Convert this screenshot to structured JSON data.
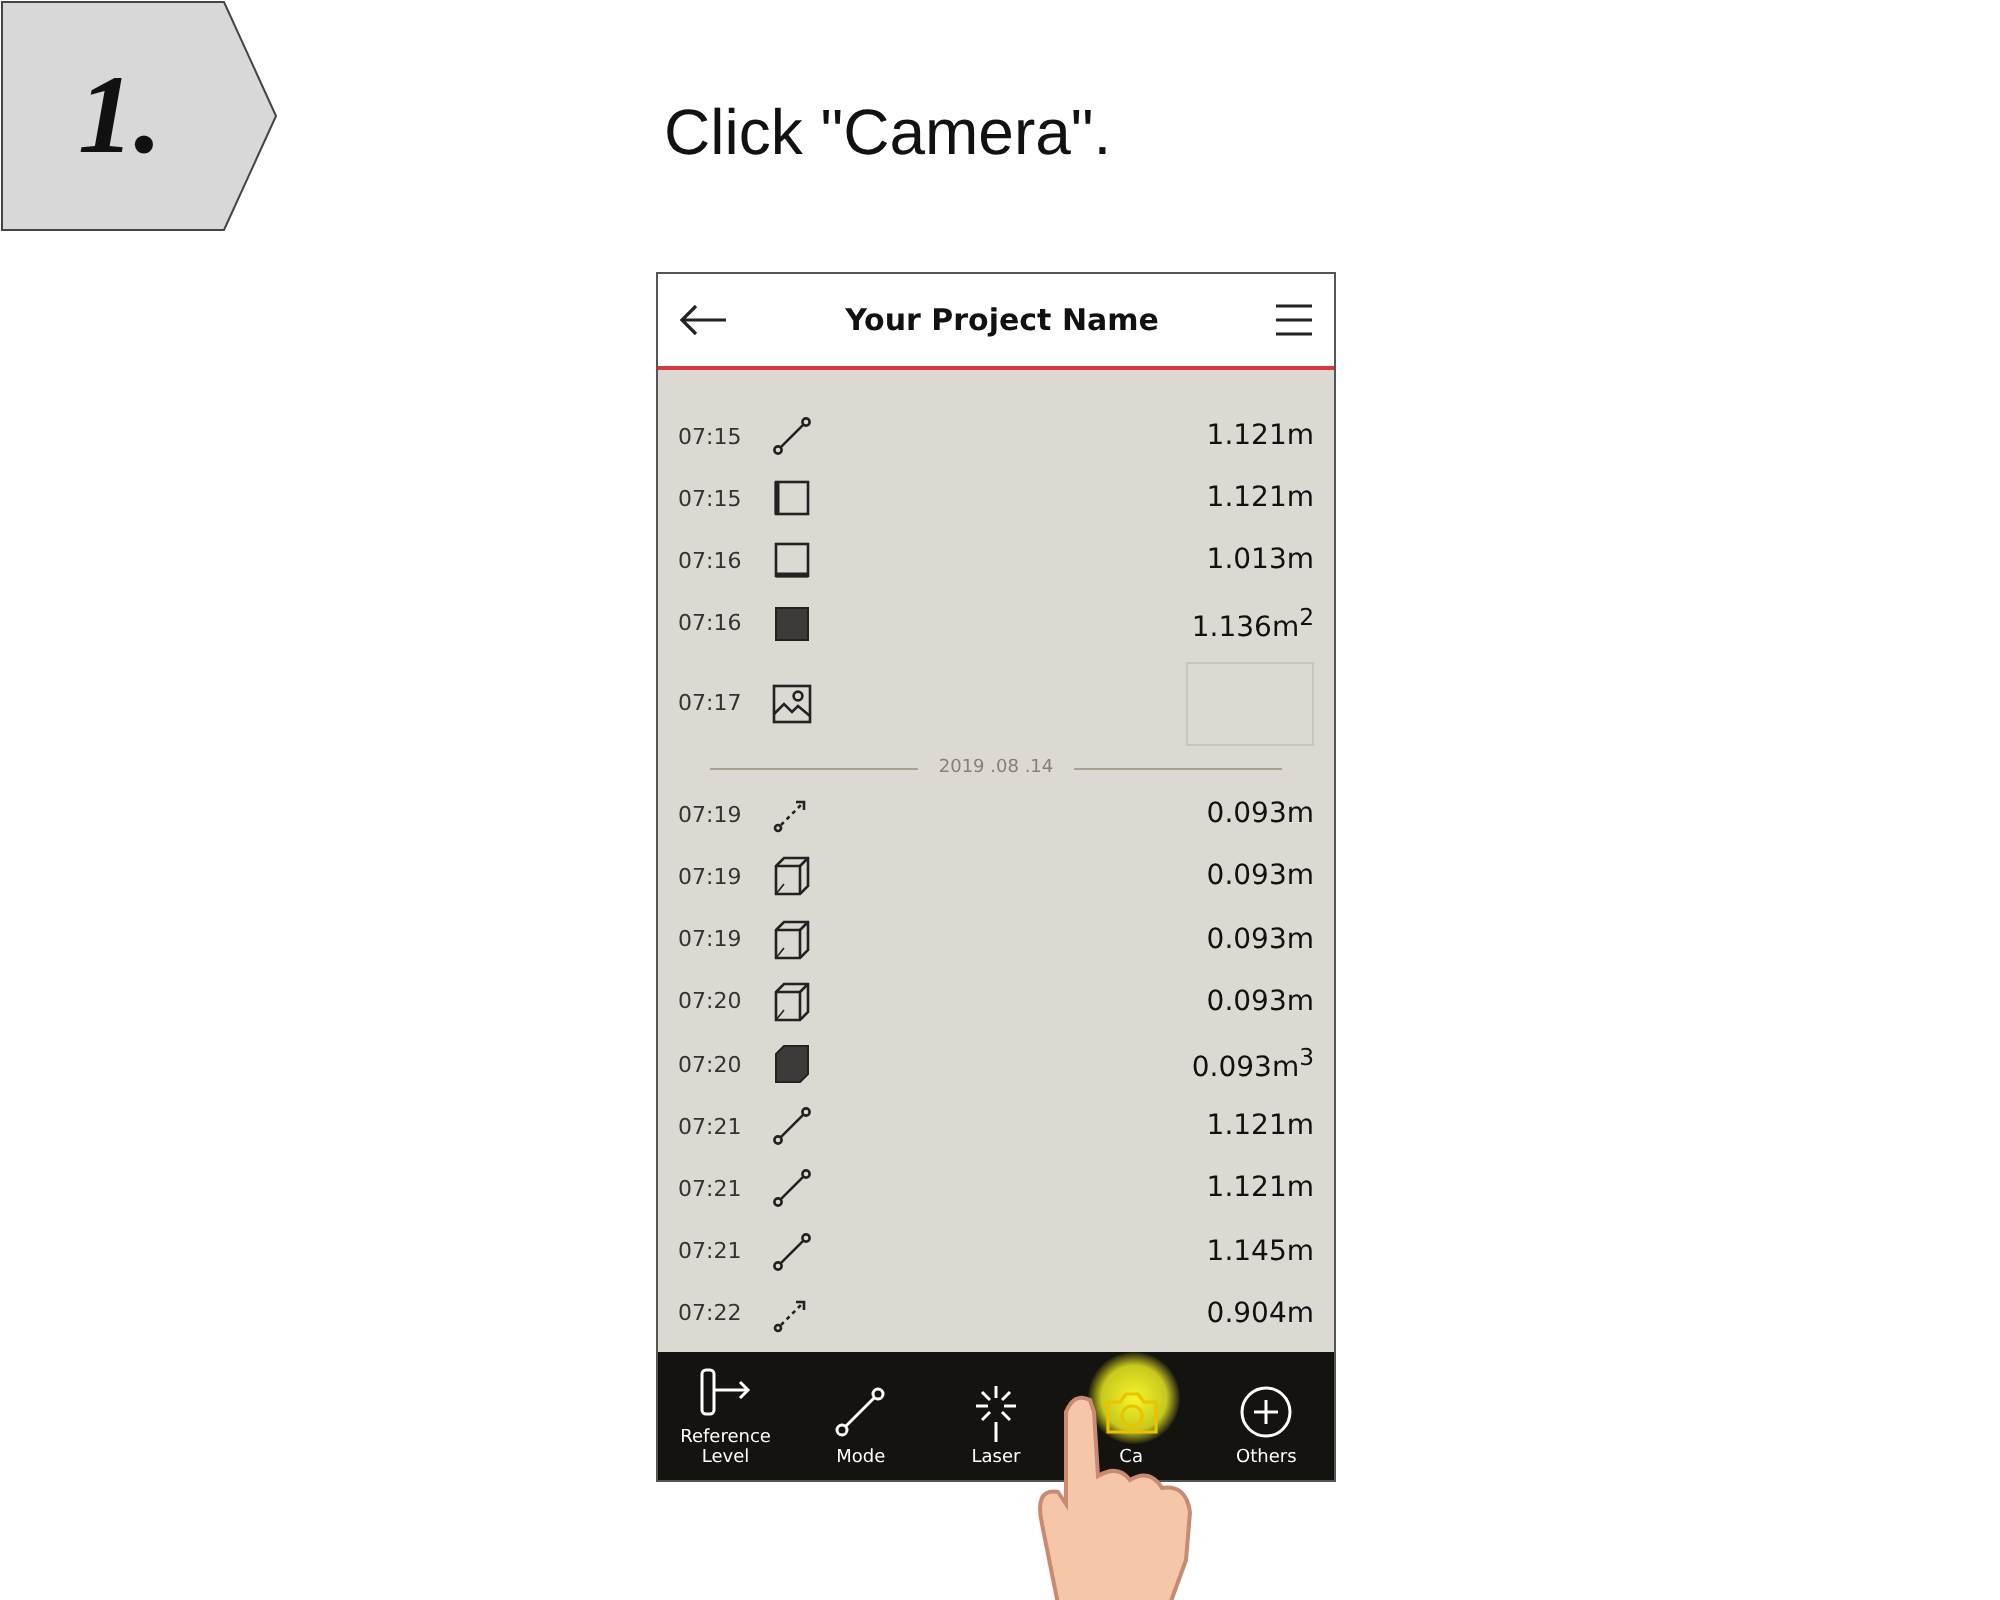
{
  "step": {
    "number": "1.",
    "instruction": "Click \"Camera\"."
  },
  "header": {
    "title": "Your Project Name"
  },
  "entries": [
    {
      "kind": "line",
      "time": "07:15",
      "value": "1.121m"
    },
    {
      "kind": "square-left",
      "time": "07:15",
      "value": "1.121m"
    },
    {
      "kind": "square-bottom",
      "time": "07:16",
      "value": "1.013m"
    },
    {
      "kind": "square-filled",
      "time": "07:16",
      "value": "1.136m$^{2}$"
    },
    {
      "kind": "image",
      "time": "07:17"
    },
    {
      "kind": "divider",
      "date": "2019 .08 .14"
    },
    {
      "kind": "dotted-arrow",
      "time": "07:19",
      "value": "0.093m"
    },
    {
      "kind": "cube",
      "time": "07:19",
      "value": "0.093m"
    },
    {
      "kind": "cube",
      "time": "07:19",
      "value": "0.093m"
    },
    {
      "kind": "cube",
      "time": "07:20",
      "value": "0.093m"
    },
    {
      "kind": "cube-filled",
      "time": "07:20",
      "value": "0.093m$^{3}$"
    },
    {
      "kind": "line",
      "time": "07:21",
      "value": "1.121m"
    },
    {
      "kind": "line",
      "time": "07:21",
      "value": "1.121m"
    },
    {
      "kind": "line",
      "time": "07:21",
      "value": "1.145m"
    },
    {
      "kind": "dotted-arrow",
      "time": "07:22",
      "value": "0.904m"
    }
  ],
  "nav": [
    {
      "kind": "reference",
      "label": "Reference Level",
      "selected": false
    },
    {
      "kind": "line",
      "label": "Mode",
      "selected": false
    },
    {
      "kind": "laser",
      "label": "Laser",
      "selected": false
    },
    {
      "kind": "camera",
      "label": "Ca",
      "selected": true
    },
    {
      "kind": "plus",
      "label": "Others",
      "selected": false
    }
  ]
}
